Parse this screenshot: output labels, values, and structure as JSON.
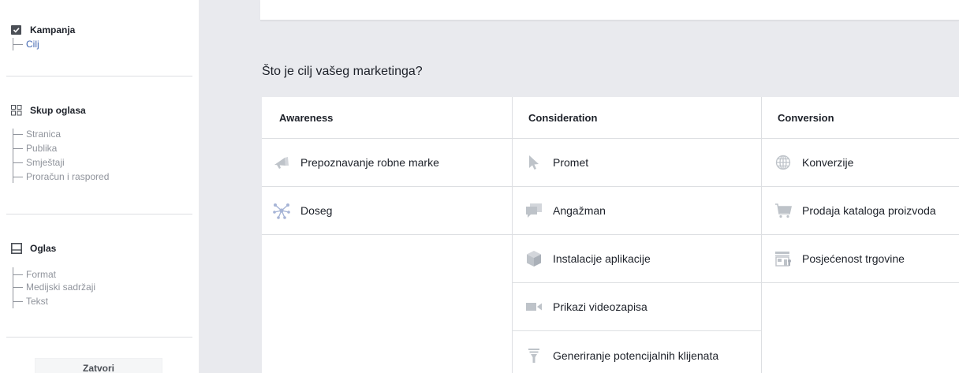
{
  "sidebar": {
    "campaign": {
      "title": "Kampanja",
      "items": [
        "Cilj"
      ]
    },
    "adset": {
      "title": "Skup oglasa",
      "items": [
        "Stranica",
        "Publika",
        "Smještaji",
        "Proračun i raspored"
      ]
    },
    "ad": {
      "title": "Oglas",
      "items": [
        "Format",
        "Medijski sadržaji",
        "Tekst"
      ]
    },
    "close_label": "Zatvori"
  },
  "main": {
    "question": "Što je cilj vašeg marketinga?",
    "columns": [
      {
        "title": "Awareness",
        "options": [
          {
            "label": "Prepoznavanje robne marke",
            "icon": "megaphone-icon"
          },
          {
            "label": "Doseg",
            "icon": "reach-icon"
          }
        ]
      },
      {
        "title": "Consideration",
        "options": [
          {
            "label": "Promet",
            "icon": "cursor-icon"
          },
          {
            "label": "Angažman",
            "icon": "chat-bubbles-icon"
          },
          {
            "label": "Instalacije aplikacije",
            "icon": "box-icon"
          },
          {
            "label": "Prikazi videozapisa",
            "icon": "video-camera-icon"
          },
          {
            "label": "Generiranje potencijalnih klijenata",
            "icon": "funnel-icon"
          }
        ]
      },
      {
        "title": "Conversion",
        "options": [
          {
            "label": "Konverzije",
            "icon": "globe-icon"
          },
          {
            "label": "Prodaja kataloga proizvoda",
            "icon": "cart-icon"
          },
          {
            "label": "Posjećenost trgovine",
            "icon": "store-icon"
          }
        ]
      }
    ]
  },
  "colors": {
    "accent": "#4267b2",
    "muted": "#90949c",
    "icon": "#bec3c9",
    "background": "#e9eaee"
  }
}
